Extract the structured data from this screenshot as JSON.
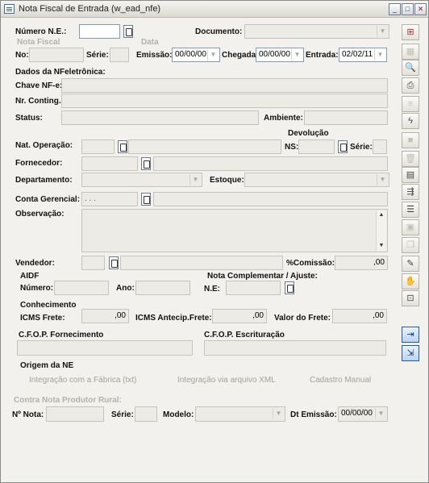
{
  "window": {
    "title": "Nota Fiscal de Entrada (w_ead_nfe)",
    "minimize": "_",
    "maximize": "□",
    "close": "✕"
  },
  "header": {
    "numero_label": "Número N.E.:",
    "numero_value": "",
    "documento_label": "Documento:",
    "documento_value": "",
    "nota_fiscal_group": "Nota Fiscal",
    "data_group": "Data",
    "no_label": "No:",
    "no_value": "",
    "serie_label": "Série:",
    "serie_value": "",
    "emissao_label": "Emissão:",
    "emissao_value": "00/00/00",
    "chegada_label": "Chegada:",
    "chegada_value": "00/00/00",
    "entrada_label": "Entrada:",
    "entrada_value": "02/02/11"
  },
  "nfe": {
    "section": "Dados da NFeletrônica:",
    "chave_label": "Chave NF-e:",
    "chave_value": "",
    "conting_label": "Nr. Conting.:",
    "conting_value": "",
    "status_label": "Status:",
    "status_value": "",
    "ambiente_label": "Ambiente:",
    "ambiente_value": ""
  },
  "devolucao": {
    "group": "Devolução",
    "ns_label": "NS:",
    "ns_value": "",
    "serie_label": "Série:",
    "serie_value": ""
  },
  "fields": {
    "nat_label": "Nat. Operação:",
    "nat_code": "",
    "nat_desc": "",
    "fornecedor_label": "Fornecedor:",
    "fornecedor_code": "",
    "fornecedor_desc": "",
    "departamento_label": "Departamento:",
    "departamento_value": "",
    "estoque_label": "Estoque:",
    "estoque_value": "",
    "conta_label": "Conta Gerencial:",
    "conta_code": ". . .",
    "conta_desc": "",
    "obs_label": "Observação:",
    "obs_value": "",
    "vendedor_label": "Vendedor:",
    "vendedor_code": "",
    "vendedor_desc": "",
    "comissao_label": "%Comissão:",
    "comissao_value": ",00"
  },
  "aidf": {
    "group": "AIDF",
    "numero_label": "Número:",
    "numero_value": "",
    "ano_label": "Ano:",
    "ano_value": ""
  },
  "complementar": {
    "group": "Nota Complementar / Ajuste:",
    "ne_label": "N.E:",
    "ne_value": ""
  },
  "conhecimento": {
    "group": "Conhecimento",
    "icms_label": "ICMS Frete:",
    "icms_value": ",00",
    "antecip_label": "ICMS Antecip.Frete:",
    "antecip_value": ",00",
    "valor_label": "Valor do Frete:",
    "valor_value": ",00"
  },
  "cfop": {
    "fornecimento_label": "C.F.O.P. Fornecimento",
    "fornecimento_value": "",
    "escrituracao_label": "C.F.O.P. Escrituração",
    "escrituracao_value": ""
  },
  "origem": {
    "group": "Origem da NE",
    "options": [
      "Integração com a Fábrica (txt)",
      "Integração via arquivo XML",
      "Cadastro Manual"
    ]
  },
  "contra": {
    "group": "Contra Nota Produtor Rural:",
    "nota_label": "Nº Nota:",
    "nota_value": "",
    "serie_label": "Série:",
    "serie_value": "",
    "modelo_label": "Modelo:",
    "modelo_value": "",
    "emissao_label": "Dt Emissão:",
    "emissao_value": "00/00/00"
  },
  "toolbar": {
    "icons": [
      "grid-add-icon",
      "table-icon",
      "document-search-icon",
      "print-icon",
      "list-icon",
      "lightning-icon",
      "disabled-square-icon",
      "trash-icon",
      "save-icon",
      "export-icon",
      "report-icon",
      "calc-icon",
      "copy-icon",
      "user-edit-icon",
      "hand-icon",
      "lock-icon",
      "insert-row-icon",
      "exit-icon"
    ]
  }
}
